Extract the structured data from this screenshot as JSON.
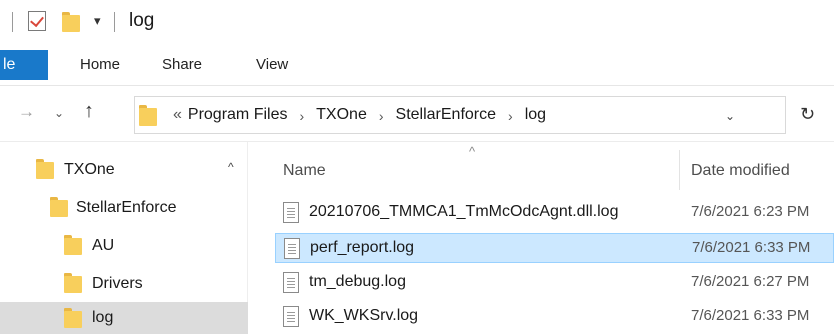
{
  "window": {
    "title": "log"
  },
  "ribbon": {
    "file_tab": "le",
    "tabs": [
      "Home",
      "Share",
      "View"
    ]
  },
  "address": {
    "path": [
      "Program Files",
      "TXOne",
      "StellarEnforce",
      "log"
    ],
    "overflow_marker": "«",
    "separator": "›"
  },
  "nav": {
    "items": [
      {
        "label": "TXOne",
        "indent": 0,
        "selected": false
      },
      {
        "label": "StellarEnforce",
        "indent": 1,
        "selected": false
      },
      {
        "label": "AU",
        "indent": 2,
        "selected": false
      },
      {
        "label": "Drivers",
        "indent": 2,
        "selected": false
      },
      {
        "label": "log",
        "indent": 2,
        "selected": true
      }
    ]
  },
  "files": {
    "columns": {
      "name": "Name",
      "date": "Date modified"
    },
    "rows": [
      {
        "name": "20210706_TMMCA1_TmMcOdcAgnt.dll.log",
        "date": "7/6/2021 6:23 PM",
        "selected": false
      },
      {
        "name": "perf_report.log",
        "date": "7/6/2021 6:33 PM",
        "selected": true
      },
      {
        "name": "tm_debug.log",
        "date": "7/6/2021 6:27 PM",
        "selected": false
      },
      {
        "name": "WK_WKSrv.log",
        "date": "7/6/2021 6:33 PM",
        "selected": false
      }
    ]
  },
  "colors": {
    "file_tab": "#1979ca",
    "selected_row": "#cce8ff",
    "folder": "#f8cf5c"
  }
}
